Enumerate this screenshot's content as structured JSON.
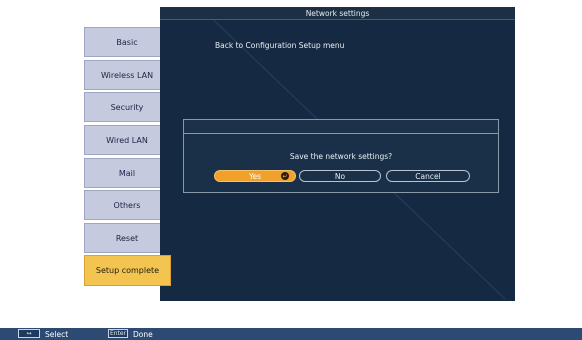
{
  "window": {
    "title": "Network settings"
  },
  "tabs": [
    {
      "label": "Basic",
      "active": false
    },
    {
      "label": "Wireless LAN",
      "active": false
    },
    {
      "label": "Security",
      "active": false
    },
    {
      "label": "Wired LAN",
      "active": false
    },
    {
      "label": "Mail",
      "active": false
    },
    {
      "label": "Others",
      "active": false
    },
    {
      "label": "Reset",
      "active": false
    },
    {
      "label": "Setup complete",
      "active": true
    }
  ],
  "main": {
    "back_link": "Back to Configuration Setup menu"
  },
  "dialog": {
    "message": "Save the network settings?",
    "options": [
      {
        "label": "Yes",
        "selected": true,
        "icon": "enter-icon"
      },
      {
        "label": "No",
        "selected": false
      },
      {
        "label": "Cancel",
        "selected": false
      }
    ]
  },
  "footer": {
    "select_key": "↔",
    "select_label": "Select",
    "done_key": "Enter",
    "done_label": "Done"
  },
  "colors": {
    "panel": "#152a42",
    "tab": "#c5cade",
    "active_tab": "#f4c451",
    "selected_option": "#f1a12b",
    "footer": "#2d4a73"
  }
}
